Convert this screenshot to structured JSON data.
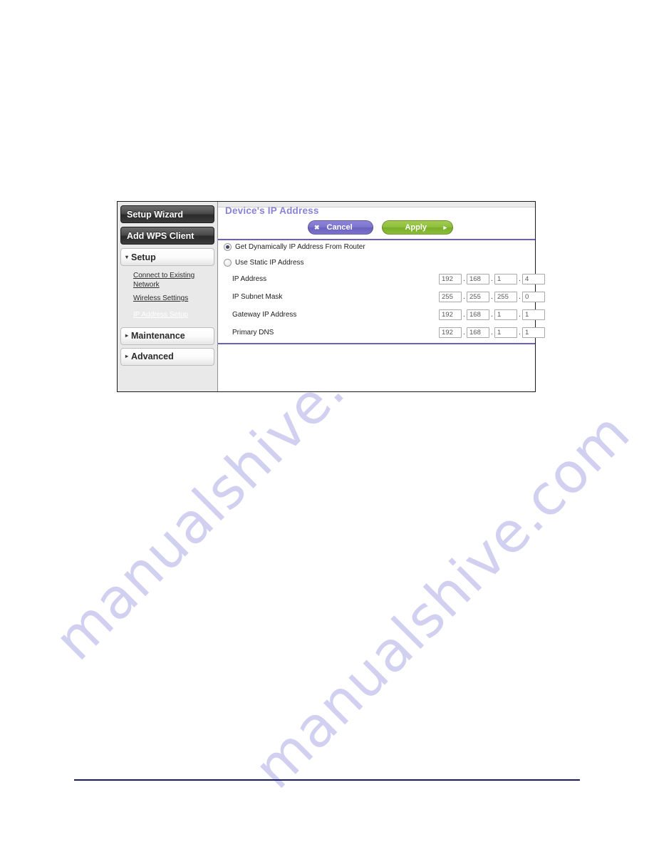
{
  "watermark": {
    "text": "manualshive.com",
    "color": "#c9c8ef"
  },
  "panel": {
    "title": "Device's IP Address",
    "accent_color": "#6b5fc0",
    "title_color": "#8a82d8"
  },
  "sidebar": {
    "top_buttons": [
      {
        "label": "Setup Wizard",
        "name": "setup-wizard"
      },
      {
        "label": "Add WPS Client",
        "name": "add-wps-client"
      }
    ],
    "setup_section": {
      "label": "Setup",
      "arrow": "▾",
      "expanded": true
    },
    "sub_items": [
      {
        "label": "Connect to Existing Network",
        "selected": false
      },
      {
        "label": "Wireless Settings",
        "selected": false
      },
      {
        "label": "IP Address Setup",
        "selected": true
      }
    ],
    "bottom_sections": [
      {
        "label": "Maintenance",
        "arrow": "▸",
        "expanded": false
      },
      {
        "label": "Advanced",
        "arrow": "▸",
        "expanded": false
      }
    ],
    "selected_color": "#8179d4"
  },
  "actions": {
    "cancel": {
      "label": "Cancel",
      "glyph": "✖",
      "color": "#7d74cf"
    },
    "apply": {
      "label": "Apply",
      "glyph": "▸",
      "color": "#8dbe3c"
    }
  },
  "radio_options": [
    {
      "label": "Get Dynamically IP Address From Router",
      "checked": true
    },
    {
      "label": "Use Static IP Address",
      "checked": false
    }
  ],
  "fields": [
    {
      "label": "IP Address",
      "octets": [
        "192",
        "168",
        "1",
        "4"
      ]
    },
    {
      "label": "IP Subnet Mask",
      "octets": [
        "255",
        "255",
        "255",
        "0"
      ]
    },
    {
      "label": "Gateway IP Address",
      "octets": [
        "192",
        "168",
        "1",
        "1"
      ]
    },
    {
      "label": "Primary DNS",
      "octets": [
        "192",
        "168",
        "1",
        "1"
      ]
    }
  ]
}
